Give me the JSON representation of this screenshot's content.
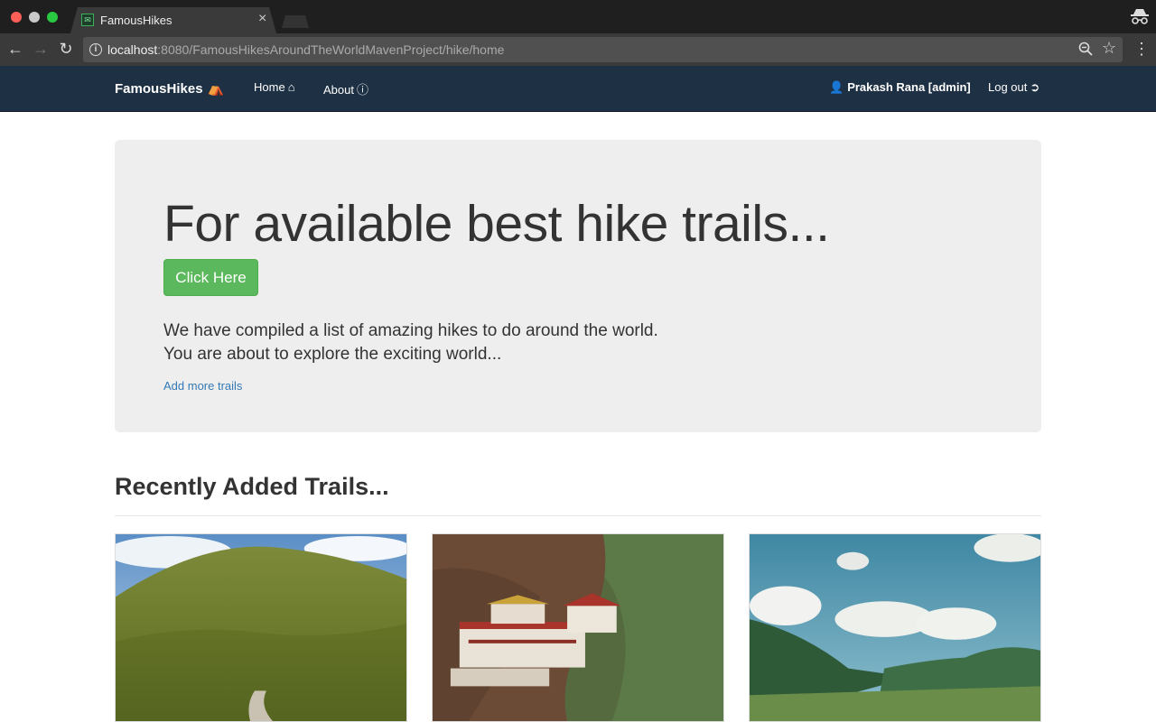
{
  "browser": {
    "tab_title": "FamousHikes",
    "tab_close": "×",
    "url_host": "localhost",
    "url_rest": ":8080/FamousHikesAroundTheWorldMavenProject/hike/home",
    "icons": [
      "back-arrow-icon",
      "forward-arrow-icon",
      "reload-icon",
      "info-icon",
      "zoom-icon",
      "bookmark-star-icon",
      "menu-icon",
      "incognito-icon"
    ]
  },
  "navbar": {
    "brand": "FamousHikes",
    "home": "Home",
    "about": "About",
    "user": "Prakash Rana [admin]",
    "logout": "Log out",
    "colors": {
      "background": "#1e3144",
      "text": "#ffffff"
    }
  },
  "jumbotron": {
    "title": "For available best hike trails...",
    "button_label": "Click Here",
    "line1": "We have compiled a list of amazing hikes to do around the world.",
    "line2": "You are about to explore the exciting world...",
    "add_link": "Add more trails",
    "colors": {
      "background": "#eeeeee",
      "button": "#5cb85c",
      "link": "#337ab7"
    }
  },
  "recent": {
    "title": "Recently Added Trails...",
    "cards": [
      {
        "image": "forested-hill-with-trail"
      },
      {
        "image": "cliffside-monastery"
      },
      {
        "image": "green-valley-with-mountains"
      }
    ]
  }
}
